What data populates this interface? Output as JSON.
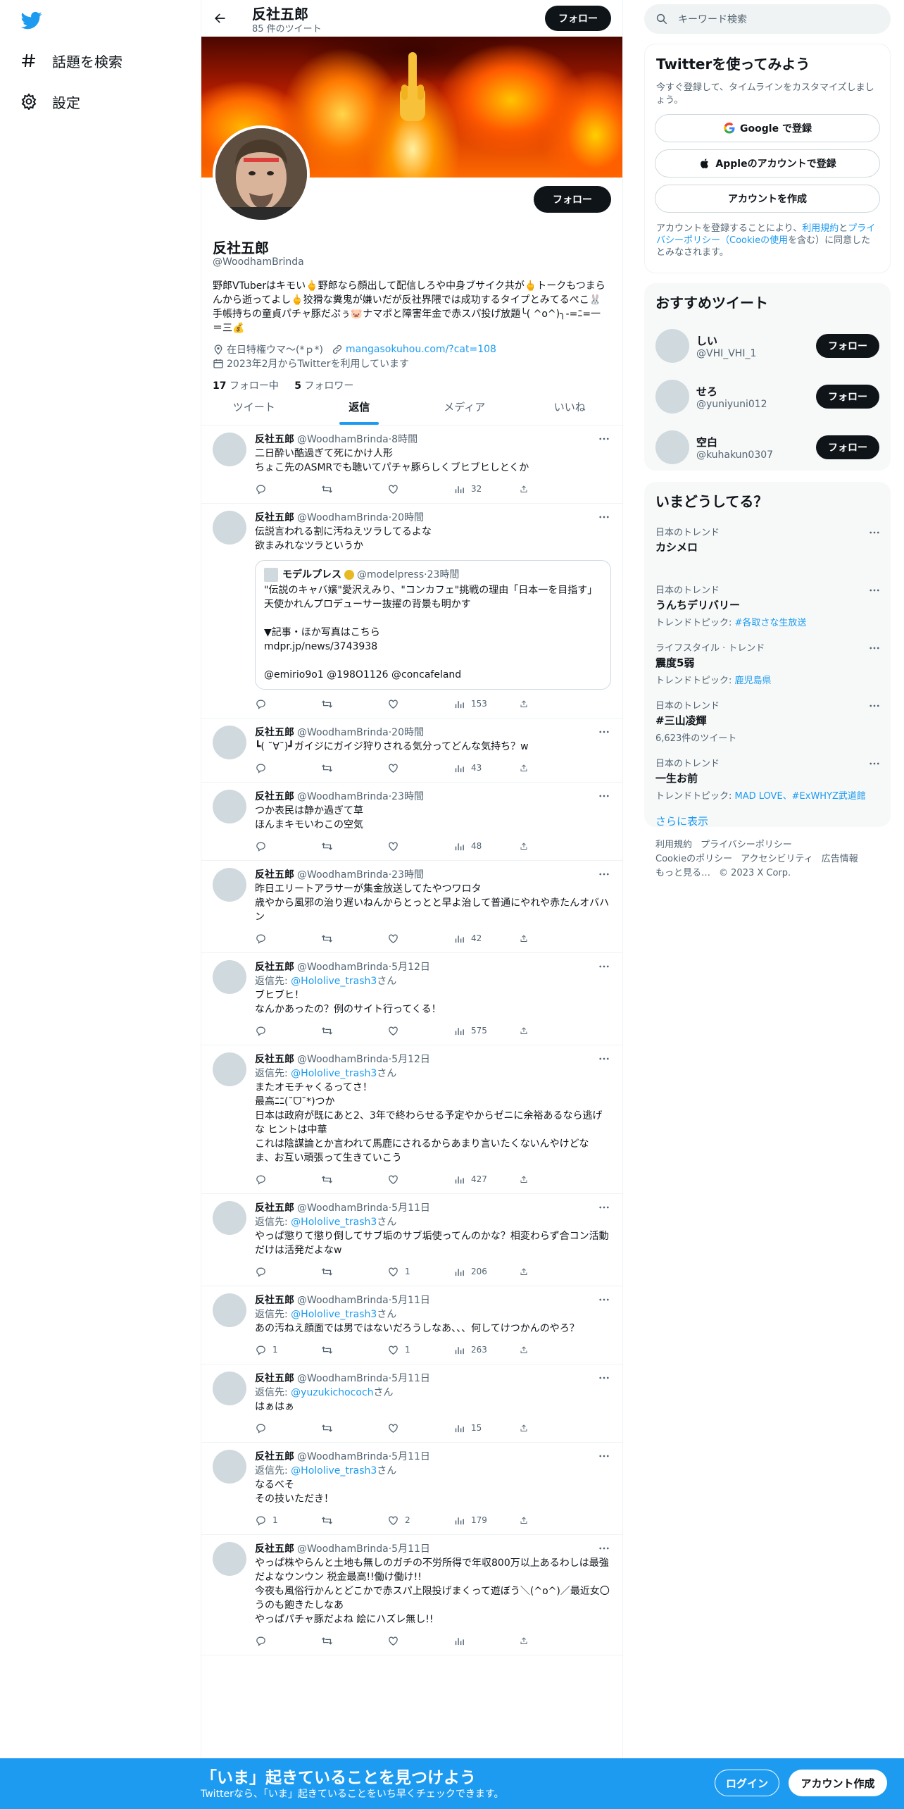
{
  "nav": {
    "explore": "話題を検索",
    "settings": "設定"
  },
  "header": {
    "name": "反社五郎",
    "tweet_count": "85 件のツイート",
    "follow": "フォロー"
  },
  "profile": {
    "follow": "フォロー",
    "name": "反社五郎",
    "handle": "@WoodhamBrinda",
    "bio": "野郎VTuberはキモい🖕野郎なら顔出して配信しろや中身ブサイク共が🖕トークもつまらんから逝ってよし🖕狡猾な糞鬼が嫌いだが反社界隈では成功するタイプとみてるぺこ🐰手帳持ちの童貞パチャ豚だぷぅ🐷ナマポと障害年金で赤スパ投げ放題╰( ^o^)╮-=ﾆ=一＝三💰",
    "location": "在日特権ウマ〜(*ｐ*)",
    "url": "mangasokuhou.com/?cat=108",
    "joined": "2023年2月からTwitterを利用しています",
    "following_count": "17",
    "following_label": "フォロー中",
    "followers_count": "5",
    "followers_label": "フォロワー"
  },
  "tabs": [
    "ツイート",
    "返信",
    "メディア",
    "いいね"
  ],
  "active_tab": "返信",
  "tweets": [
    {
      "name": "反社五郎",
      "handle": "@WoodhamBrinda",
      "time": "8時間",
      "text": "二日酔い酷過ぎて死にかけ人形\nちょこ先のASMRでも聴いてパチャ豚らしくブヒブヒしとくか",
      "reply": "",
      "rt": "",
      "like": "",
      "views": "32"
    },
    {
      "name": "反社五郎",
      "handle": "@WoodhamBrinda",
      "time": "20時間",
      "text": "伝説言われる割に汚ねえツラしてるよな\n欲まみれなツラというか",
      "reply": "",
      "rt": "",
      "like": "",
      "views": "153",
      "quote": {
        "name": "モデルプレス",
        "handle": "@modelpress",
        "time": "23時間",
        "text": "\"伝説のキャバ嬢\"愛沢えみり、\"コンカフェ\"挑戦の理由「日本一を目指す」天使かれんプロデューサー抜擢の背景も明かす\n\n▼記事・ほか写真はこちら\nmdpr.jp/news/3743938\n\n@emirio9o1 @198O1126 @concafeland"
      }
    },
    {
      "name": "反社五郎",
      "handle": "@WoodhamBrinda",
      "time": "20時間",
      "text": "┗( ˘∀˘)┛ガイジにガイジ狩りされる気分ってどんな気持ち？w",
      "reply": "",
      "rt": "",
      "like": "",
      "views": "43"
    },
    {
      "name": "反社五郎",
      "handle": "@WoodhamBrinda",
      "time": "23時間",
      "text": "つか表民は静か過ぎて草\nほんまキモいわこの空気",
      "reply": "",
      "rt": "",
      "like": "",
      "views": "48"
    },
    {
      "name": "反社五郎",
      "handle": "@WoodhamBrinda",
      "time": "23時間",
      "text": "昨日エリートアラサーが集金放送してたやつワロタ\n歳やから風邪の治り遅いねんからとっとと早よ治して普通にやれや赤たんオバハン",
      "reply": "",
      "rt": "",
      "like": "",
      "views": "42"
    },
    {
      "name": "反社五郎",
      "handle": "@WoodhamBrinda",
      "time": "5月12日",
      "replying": "@Hololive_trash3",
      "text": "ブヒブヒ！\nなんかあったの？例のサイト行ってくる！",
      "reply": "",
      "rt": "",
      "like": "",
      "views": "575"
    },
    {
      "name": "反社五郎",
      "handle": "@WoodhamBrinda",
      "time": "5月12日",
      "replying": "@Hololive_trash3",
      "text": "またオモチャくるってさ！\n最高ﾆﾆ(˘ᗜ˘*)つか\n日本は政府が既にあと2、3年で終わらせる予定やからゼニに余裕あるなら逃げな ヒントは中華\nこれは陰謀論とか言われて馬鹿にされるからあまり言いたくないんやけどな\nま、お互い頑張って生きていこう",
      "reply": "",
      "rt": "",
      "like": "",
      "views": "427"
    },
    {
      "name": "反社五郎",
      "handle": "@WoodhamBrinda",
      "time": "5月11日",
      "replying": "@Hololive_trash3",
      "text": "やっぱ懲りて懲り倒してサブ垢のサブ垢使ってんのかな？相変わらず合コン活動だけは活発だよなw",
      "reply": "",
      "rt": "",
      "like": "1",
      "views": "206"
    },
    {
      "name": "反社五郎",
      "handle": "@WoodhamBrinda",
      "time": "5月11日",
      "replying": "@Hololive_trash3",
      "text": "あの汚ねえ顔面では男ではないだろうしなあ、、、何してけつかんのやろ？",
      "reply": "1",
      "rt": "",
      "like": "1",
      "views": "263"
    },
    {
      "name": "反社五郎",
      "handle": "@WoodhamBrinda",
      "time": "5月11日",
      "replying": "@yuzukichococh",
      "text": "はぁはぁ",
      "reply": "",
      "rt": "",
      "like": "",
      "views": "15"
    },
    {
      "name": "反社五郎",
      "handle": "@WoodhamBrinda",
      "time": "5月11日",
      "replying": "@Hololive_trash3",
      "text": "なるべそ\nその技いただき！",
      "reply": "1",
      "rt": "",
      "like": "2",
      "views": "179"
    },
    {
      "name": "反社五郎",
      "handle": "@WoodhamBrinda",
      "time": "5月11日",
      "text": "やっぱ株やらんと土地も無しのガチの不労所得で年収800万以上あるわしは最強だよなウンウン 税金最高!!働け働け!!\n今夜も風俗行かんとどこかで赤スパ上限投げまくって遊ぼう＼(^o^)／最近女〇うのも飽きたしなあ\nやっぱパチャ豚だよね 絵にハズレ無し!!",
      "reply": "",
      "rt": "",
      "like": "",
      "views": ""
    }
  ],
  "reply_prefix": "返信先: ",
  "reply_suffix": "さん",
  "right": {
    "search_placeholder": "キーワード検索",
    "try_title": "Twitterを使ってみよう",
    "try_sub": "今すぐ登録して、タイムラインをカスタマイズしましょう。",
    "google": "Google で登録",
    "apple": "Appleのアカウントで登録",
    "create": "アカウントを作成",
    "terms_a": "アカウントを登録することにより、",
    "terms_link1": "利用規約",
    "terms_and": "と",
    "terms_link2": "プライバシーポリシー（Cookieの使用",
    "terms_b": "を含む）に同意したとみなされます。",
    "rec_title": "おすすめツイート",
    "rec_users": [
      {
        "name": "しい",
        "handle": "@VHI_VHI_1",
        "btn": "フォロー"
      },
      {
        "name": "せろ",
        "handle": "@yuniyuni012",
        "btn": "フォロー"
      },
      {
        "name": "空白",
        "handle": "@kuhakun0307",
        "btn": "フォロー"
      }
    ],
    "trend_title": "いまどうしてる？",
    "trends": [
      {
        "cat": "日本のトレンド",
        "title": "カシメロ",
        "sub": "",
        "subpre": ""
      },
      {
        "cat": "日本のトレンド",
        "title": "うんちデリバリー",
        "subpre": "トレンドトピック: ",
        "sub": "#各取さな生放送"
      },
      {
        "cat": "ライフスタイル · トレンド",
        "title": "震度5弱",
        "subpre": "トレンドトピック: ",
        "sub": "鹿児島県"
      },
      {
        "cat": "日本のトレンド",
        "title": "#三山凌輝",
        "subpre": "6,623件のツイート",
        "sub": ""
      },
      {
        "cat": "日本のトレンド",
        "title": "一生お前",
        "subpre": "トレンドトピック: ",
        "sub": "MAD LOVE、#ExWHYZ武道館"
      }
    ],
    "show_more": "さらに表示",
    "footer": [
      "利用規約",
      "プライバシーポリシー",
      "Cookieのポリシー",
      "アクセシビリティ",
      "広告情報",
      "もっと見る…",
      "© 2023 X Corp."
    ]
  },
  "bottom": {
    "title": "「いま」起きていることを見つけよう",
    "sub": "Twitterなら、「いま」起きていることをいち早くチェックできます。",
    "login": "ログイン",
    "signup": "アカウント作成"
  },
  "colors": {
    "accent": "#1d9bf0",
    "dark": "#0f1419",
    "muted": "#536471"
  }
}
